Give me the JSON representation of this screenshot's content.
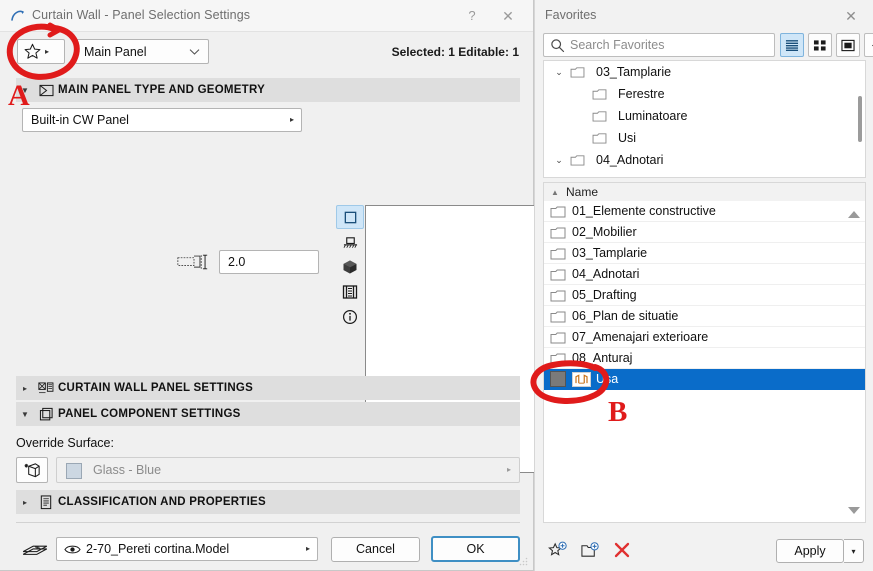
{
  "dialog": {
    "title": "Curtain Wall - Panel Selection Settings",
    "app_icon": "archicad-icon",
    "help_label": "?",
    "close_label": "✕",
    "favorites_button": {
      "icon": "star-icon",
      "arrow": "▸"
    },
    "panel_selector": {
      "value": "Main Panel",
      "chevron": "⌄"
    },
    "selection_info": "Selected: 1 Editable: 1",
    "sections": {
      "geometry": {
        "label": "MAIN PANEL TYPE AND GEOMETRY",
        "expanded_triangle": "▼",
        "icon": "panel-geometry-icon"
      },
      "curtain_wall_panel": {
        "label": "CURTAIN WALL PANEL SETTINGS",
        "collapsed_triangle": "▸",
        "icon": "cw-panel-icon"
      },
      "panel_component": {
        "label": "PANEL COMPONENT SETTINGS",
        "expanded_triangle": "▼",
        "icon": "component-icon"
      },
      "classification": {
        "label": "CLASSIFICATION AND PROPERTIES",
        "collapsed_triangle": "▸",
        "icon": "classification-icon"
      }
    },
    "geometry": {
      "panel_type": "Built-in CW Panel",
      "panel_type_arrow": "▸",
      "thickness_icon": "thickness-icon",
      "thickness_value": "2.0",
      "view_buttons": [
        {
          "name": "floor-plan-view-icon",
          "selected": true
        },
        {
          "name": "section-view-icon",
          "selected": false
        },
        {
          "name": "3d-view-icon",
          "selected": false
        },
        {
          "name": "model-view-icon",
          "selected": false
        },
        {
          "name": "info-icon",
          "selected": false
        }
      ],
      "preview_label": ""
    },
    "panel_component": {
      "override_surface_label": "Override Surface:",
      "surface_button_icon": "surface-override-icon",
      "surface_swatch_color": "#ccd7e2",
      "surface_name": "Glass - Blue",
      "surface_arrow": "▸"
    },
    "footer": {
      "layer_icon": "layers-icon",
      "layer_eye_icon": "eye-icon",
      "layer_value": "2-70_Pereti cortina.Model",
      "layer_arrow": "▸",
      "cancel_label": "Cancel",
      "ok_label": "OK"
    }
  },
  "favorites": {
    "title": "Favorites",
    "close_label": "✕",
    "search": {
      "icon": "search-icon",
      "placeholder": "Search Favorites",
      "value": ""
    },
    "view_modes": [
      {
        "name": "list-view-icon",
        "selected": true
      },
      {
        "name": "grid-view-icon",
        "selected": false
      },
      {
        "name": "large-icon-view-icon",
        "selected": false
      },
      {
        "name": "settings-gear-icon",
        "selected": false,
        "arrow": "▸"
      }
    ],
    "tree": [
      {
        "label": "03_Tamplarie",
        "indent": 0,
        "twisty": "⌄",
        "icon": "folder-icon"
      },
      {
        "label": "Ferestre",
        "indent": 1,
        "twisty": "",
        "icon": "folder-icon"
      },
      {
        "label": "Luminatoare",
        "indent": 1,
        "twisty": "",
        "icon": "folder-icon"
      },
      {
        "label": "Usi",
        "indent": 1,
        "twisty": "",
        "icon": "folder-icon"
      },
      {
        "label": "04_Adnotari",
        "indent": 0,
        "twisty": "⌄",
        "icon": "folder-icon"
      }
    ],
    "list_header": {
      "sort_arrow": "▲",
      "name_column": "Name"
    },
    "list": [
      {
        "label": "01_Elemente constructive",
        "icon": "folder-icon",
        "selected": false
      },
      {
        "label": "02_Mobilier",
        "icon": "folder-icon",
        "selected": false
      },
      {
        "label": "03_Tamplarie",
        "icon": "folder-icon",
        "selected": false
      },
      {
        "label": "04_Adnotari",
        "icon": "folder-icon",
        "selected": false
      },
      {
        "label": "05_Drafting",
        "icon": "folder-icon",
        "selected": false
      },
      {
        "label": "06_Plan de situatie",
        "icon": "folder-icon",
        "selected": false
      },
      {
        "label": "07_Amenajari exterioare",
        "icon": "folder-icon",
        "selected": false
      },
      {
        "label": "08_Anturaj",
        "icon": "folder-icon",
        "selected": false
      },
      {
        "label": "Usa",
        "icon": "favorite-thumb-icon",
        "selected": true
      }
    ],
    "toolbar": [
      {
        "name": "add-favorite-icon"
      },
      {
        "name": "new-folder-icon"
      },
      {
        "name": "delete-favorite-icon"
      }
    ],
    "apply_label": "Apply",
    "apply_arrow": "▾"
  },
  "annotations": {
    "color": "#e01b1b",
    "marker_a": "A",
    "marker_b": "B"
  }
}
